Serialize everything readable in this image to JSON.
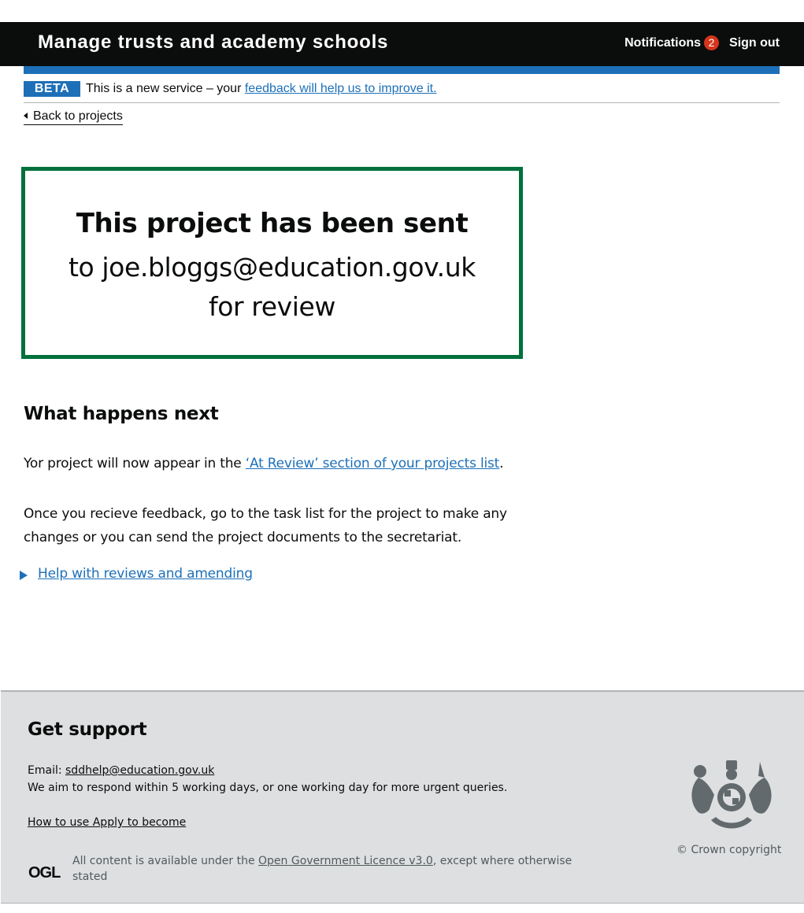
{
  "header": {
    "title": "Manage trusts and academy schools",
    "notifications_label": "Notifications",
    "notifications_count": "2",
    "sign_out_label": "Sign out"
  },
  "phase_banner": {
    "tag": "BETA",
    "text": "This is a new service – your",
    "link": "feedback will help us to improve it."
  },
  "back_link": "Back to projects",
  "panel": {
    "title": "This project has been sent",
    "line1": "to joe.bloggs@education.gov.uk",
    "line2": "for review"
  },
  "next": {
    "heading": "What happens next",
    "para1_prefix": "Yor project will now appear in the",
    "para1_link": "‘At Review’ section of your projects list",
    "para1_suffix": ".",
    "para2": "Once you recieve feedback, go to the task list for the project to make any changes or you can send the project documents to the secretariat.",
    "details_summary": "Help with reviews and amending"
  },
  "footer": {
    "heading": "Get support",
    "email_label": "Email:",
    "email": "sddhelp@education.gov.uk",
    "respond_text": "We aim to respond within 5 working days, or one working day for more urgent queries.",
    "how_to_link": "How to use Apply to become",
    "ogl_logo": "OGL",
    "licence_prefix": "All content is available under the",
    "licence_link": "Open Government Licence v3.0",
    "licence_suffix": ", except where otherwise stated",
    "copyright": "© Crown copyright"
  },
  "colors": {
    "header_bg": "#0b0c0c",
    "brand_blue": "#1d70b8",
    "panel_border": "#00703c",
    "badge_red": "#d4351c",
    "footer_bg": "#dedfe0"
  },
  "icons": [
    "back-chevron-icon",
    "details-triangle-icon",
    "royal-crest-icon",
    "ogl-icon"
  ]
}
